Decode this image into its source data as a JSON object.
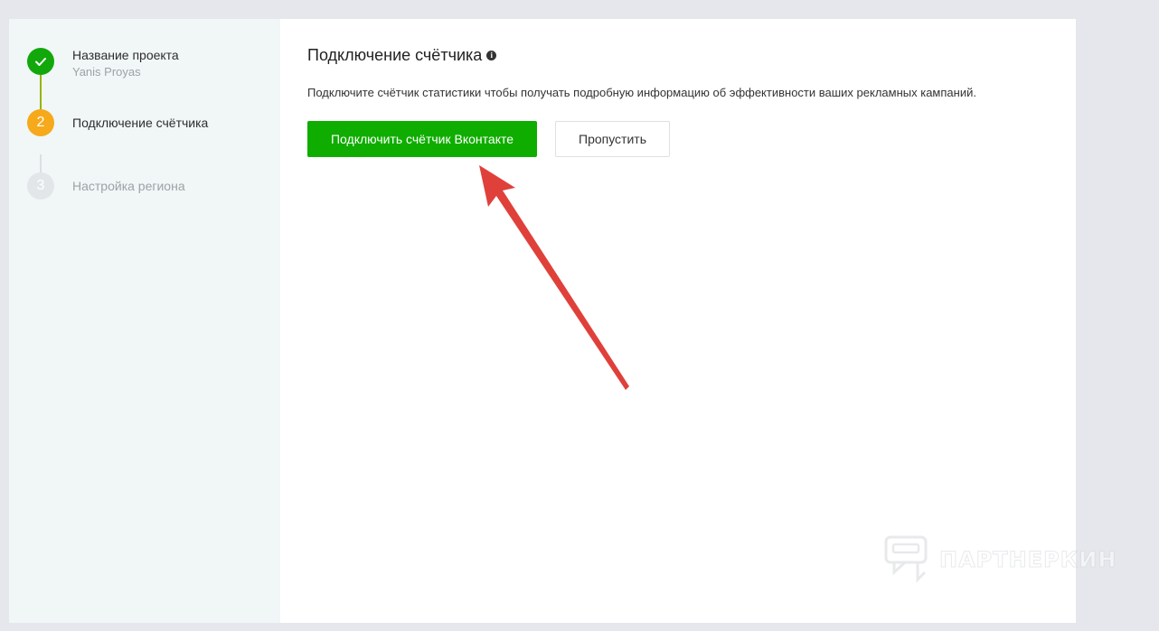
{
  "steps": [
    {
      "number": "",
      "title": "Название проекта",
      "subtitle": "Yanis Proyas",
      "state": "done"
    },
    {
      "number": "2",
      "title": "Подключение счётчика",
      "state": "active"
    },
    {
      "number": "3",
      "title": "Настройка региона",
      "state": "pending"
    }
  ],
  "main": {
    "title": "Подключение счётчика",
    "description": "Подключите счётчик статистики чтобы получать подробную информацию об эффективности ваших рекламных кампаний.",
    "connect_button": "Подключить счётчик Вконтакте",
    "skip_button": "Пропустить"
  },
  "watermark": {
    "text": "ПАРТНЕРКИН"
  },
  "colors": {
    "step_done": "#12a80c",
    "step_active": "#f6a91a",
    "step_pending": "#e3e6e8",
    "primary_button": "#0fad00",
    "annotation_arrow": "#e0403a"
  },
  "icons": {
    "step_done": "check-icon",
    "title_info": "info-icon"
  }
}
